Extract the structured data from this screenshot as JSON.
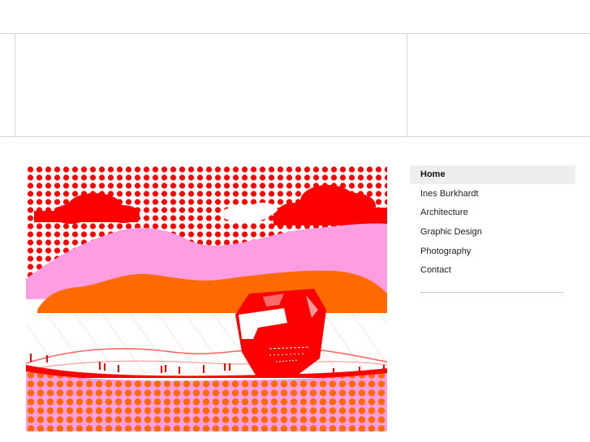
{
  "nav": {
    "items": [
      {
        "label": "Home",
        "active": true
      },
      {
        "label": "Ines Burkhardt",
        "active": false
      },
      {
        "label": "Architecture",
        "active": false
      },
      {
        "label": "Graphic Design",
        "active": false
      },
      {
        "label": "Photography",
        "active": false
      },
      {
        "label": "Contact",
        "active": false
      }
    ]
  },
  "artwork": {
    "colors": {
      "red": "#ff0000",
      "pink": "#ff9de2",
      "orange": "#ff6a00",
      "white": "#ffffff",
      "grid": "#ffc4c4"
    }
  }
}
